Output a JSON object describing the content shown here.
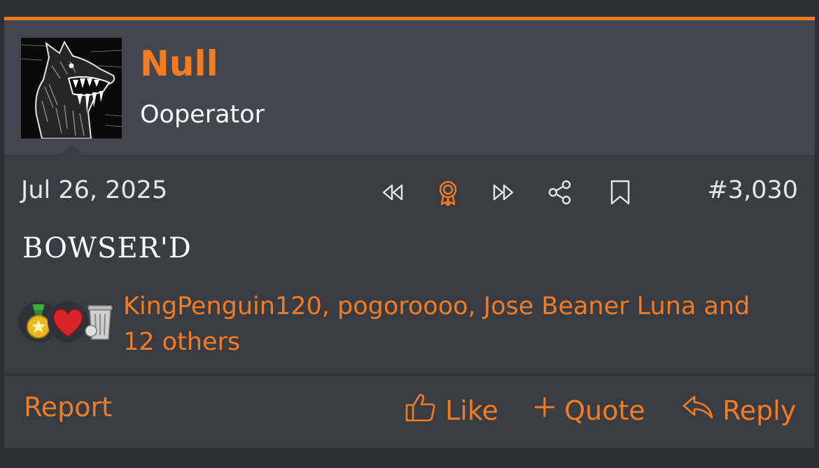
{
  "user": {
    "name": "Null",
    "title": "Ooperator"
  },
  "post": {
    "date": "Jul 26, 2025",
    "number": "#3,030",
    "message": "BOWSER'D"
  },
  "toolbar": {
    "icons": [
      "rewind-icon",
      "award-icon",
      "fast-forward-icon",
      "share-icon",
      "bookmark-icon"
    ]
  },
  "reactions": {
    "icons": [
      "medal-icon",
      "heart-icon",
      "trash-can-icon"
    ],
    "text": "KingPenguin120, pogoroooo, Jose Beaner Luna and 12 others"
  },
  "actions": {
    "report": "Report",
    "like": "Like",
    "quote": "Quote",
    "reply": "Reply"
  },
  "colors": {
    "accent": "#f47c20",
    "post_bg": "#393c43",
    "header_bg": "#43464e",
    "page_bg": "#2c2f35"
  }
}
